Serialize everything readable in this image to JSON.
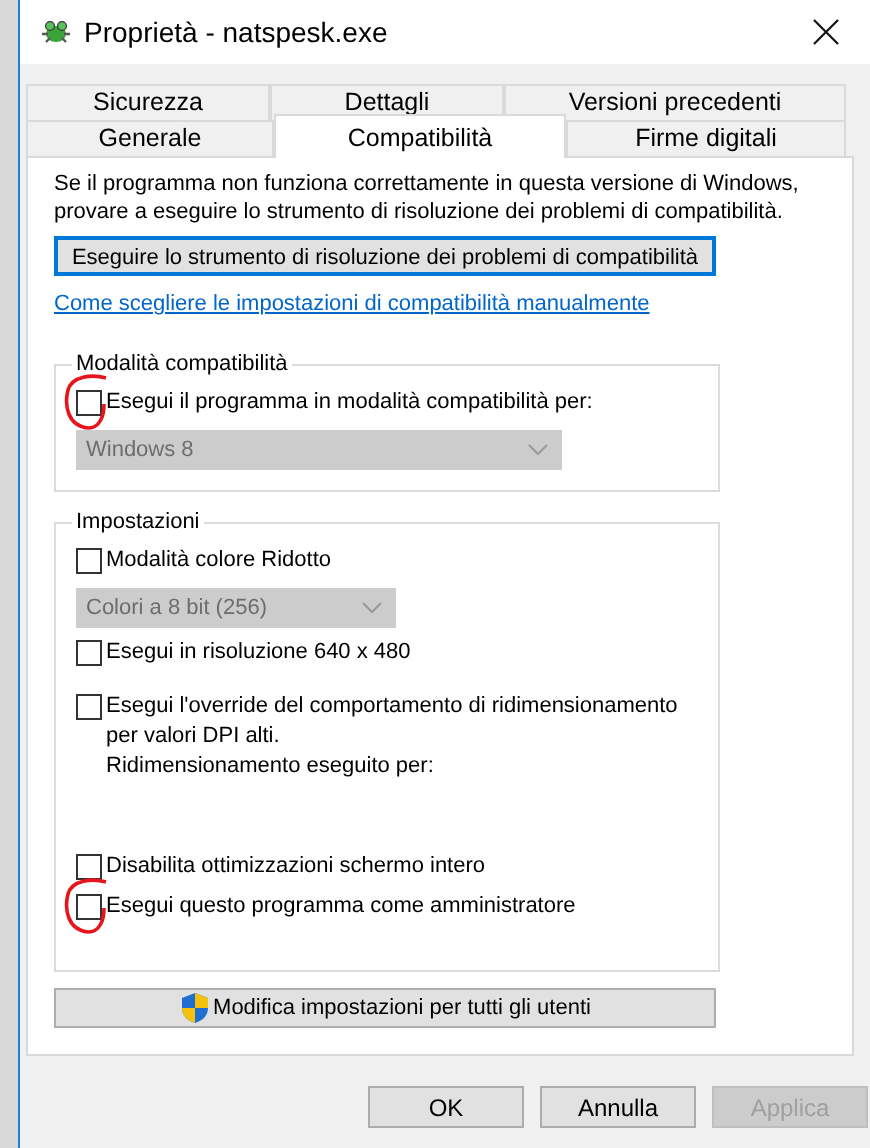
{
  "window": {
    "title": "Proprietà - natspesk.exe"
  },
  "tab_rows": [
    {
      "tabs": [
        {
          "label": "Sicurezza",
          "selected": false
        },
        {
          "label": "Dettagli",
          "selected": false
        },
        {
          "label": "Versioni precedenti",
          "selected": false
        }
      ]
    },
    {
      "tabs": [
        {
          "label": "Generale",
          "selected": false
        },
        {
          "label": "Compatibilità",
          "selected": true
        },
        {
          "label": "Firme digitali",
          "selected": false
        }
      ]
    }
  ],
  "description": "Se il programma non funziona correttamente in questa versione di Windows, provare a eseguire lo strumento di risoluzione dei problemi di compatibilità.",
  "troubleshoot_button": "Eseguire lo strumento di risoluzione dei problemi di compatibilità",
  "manual_link": "Come scegliere le impostazioni di compatibilità manualmente",
  "compatibility_group": {
    "title": "Modalità compatibilità",
    "items": [
      {
        "kind": "checkbox",
        "label": "Esegui il programma in modalità compatibilità per:",
        "checked": false,
        "circled": true
      },
      {
        "kind": "dropdown",
        "value": "Windows 8",
        "disabled": true
      }
    ]
  },
  "settings_group": {
    "title": "Impostazioni",
    "items": [
      {
        "kind": "checkbox",
        "label": "Modalità colore Ridotto",
        "checked": false,
        "circled": false
      },
      {
        "kind": "dropdown",
        "value": "Colori a 8 bit (256)",
        "disabled": true
      },
      {
        "kind": "checkbox",
        "label": "Esegui in risoluzione 640 x 480",
        "checked": false,
        "circled": false
      },
      {
        "kind": "checkbox",
        "label": "Esegui l'override del comportamento di ridimensionamento per valori DPI alti.",
        "note": "Ridimensionamento eseguito per:",
        "checked": false,
        "circled": false
      },
      {
        "kind": "checkbox",
        "label": "Disabilita ottimizzazioni schermo intero",
        "checked": false,
        "circled": false
      },
      {
        "kind": "checkbox",
        "label": "Esegui questo programma come amministratore",
        "checked": false,
        "circled": true
      }
    ]
  },
  "all_users_button": "Modifica impostazioni per tutti gli utenti",
  "buttons": [
    {
      "label": "OK",
      "disabled": false
    },
    {
      "label": "Annulla",
      "disabled": false
    },
    {
      "label": "Applica",
      "disabled": true
    }
  ]
}
